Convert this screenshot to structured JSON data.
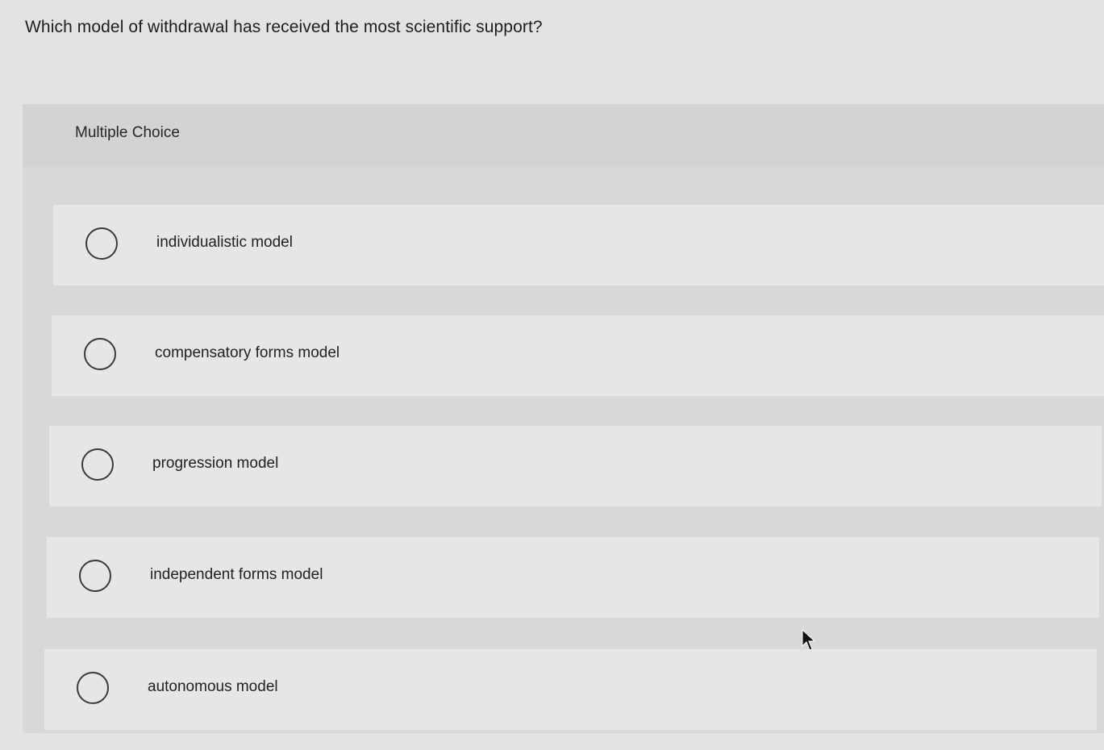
{
  "question": {
    "text": "Which model of withdrawal has received the most scientific support?"
  },
  "panel": {
    "header_label": "Multiple Choice"
  },
  "options": [
    {
      "label": "individualistic model",
      "selected": false
    },
    {
      "label": "compensatory forms model",
      "selected": false
    },
    {
      "label": "progression model",
      "selected": false
    },
    {
      "label": "independent forms model",
      "selected": false
    },
    {
      "label": "autonomous model",
      "selected": false
    }
  ],
  "icons": {
    "radio": "radio-unselected-icon",
    "cursor": "mouse-pointer-icon"
  }
}
